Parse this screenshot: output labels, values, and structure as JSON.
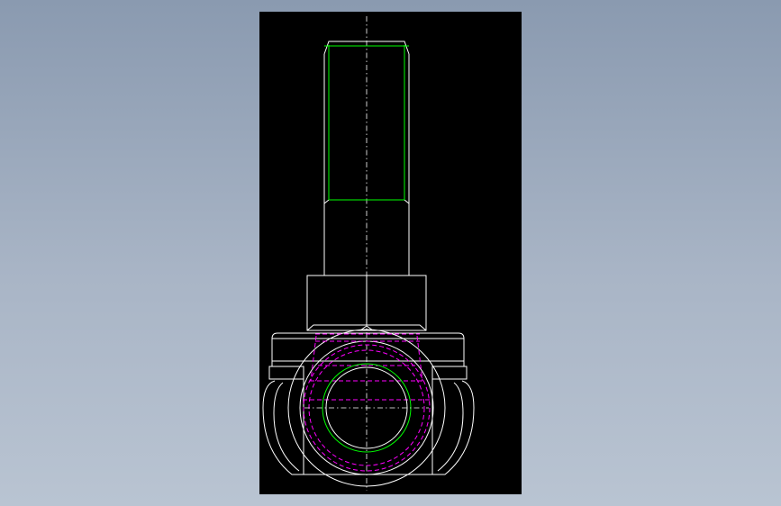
{
  "drawing": {
    "background_color": "#000000",
    "colors": {
      "outline": "#ffffff",
      "thread": "#00ff00",
      "hidden": "#ff00ff",
      "centerline": "#ffffff"
    }
  }
}
